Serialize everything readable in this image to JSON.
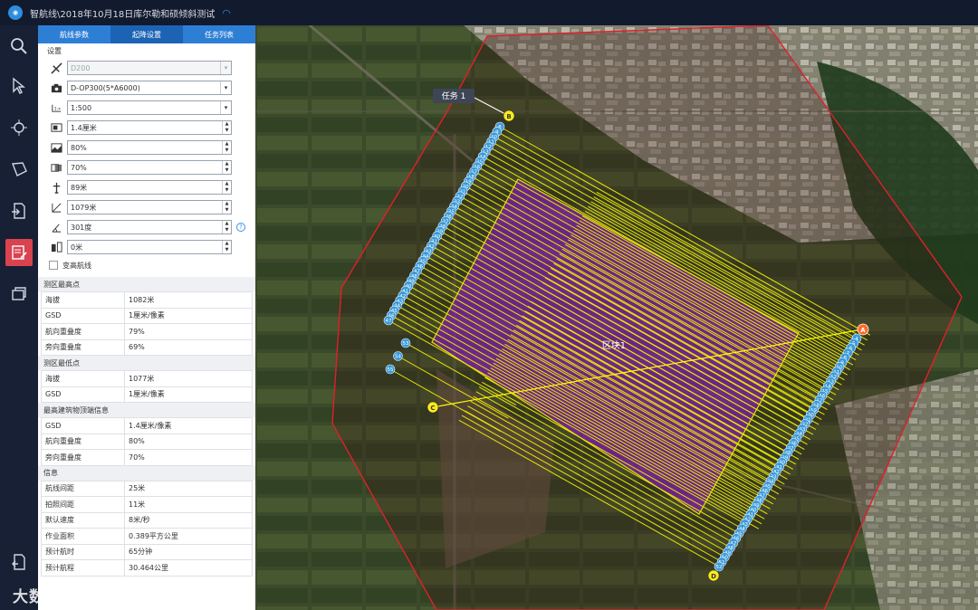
{
  "window": {
    "title": "智航线\\2018年10月18日库尔勒和硕倾斜测试"
  },
  "tabs": [
    {
      "label": "航线参数"
    },
    {
      "label": "起降设置"
    },
    {
      "label": "任务列表"
    }
  ],
  "settings": {
    "heading": "设置",
    "drone": "D200",
    "camera": "D-OP300(5*A6000)",
    "scale": "1:500",
    "gsd": "1.4厘米",
    "forward_overlap": "80%",
    "side_overlap": "70%",
    "altitude": "89米",
    "length": "1079米",
    "heading_angle": "301度",
    "offset": "0米",
    "checkbox_label": "变高航线"
  },
  "highest": {
    "heading": "测区最高点",
    "rows": [
      {
        "k": "海拔",
        "v": "1082米"
      },
      {
        "k": "GSD",
        "v": "1厘米/像素"
      },
      {
        "k": "航向重叠度",
        "v": "79%"
      },
      {
        "k": "旁向重叠度",
        "v": "69%"
      }
    ]
  },
  "lowest": {
    "heading": "测区最低点",
    "rows": [
      {
        "k": "海拔",
        "v": "1077米"
      },
      {
        "k": "GSD",
        "v": "1厘米/像素"
      }
    ]
  },
  "building": {
    "heading": "最高建筑物顶端信息",
    "rows": [
      {
        "k": "GSD",
        "v": "1.4厘米/像素"
      },
      {
        "k": "航向重叠度",
        "v": "80%"
      },
      {
        "k": "旁向重叠度",
        "v": "70%"
      }
    ]
  },
  "info": {
    "heading": "信息",
    "rows": [
      {
        "k": "航线间距",
        "v": "25米"
      },
      {
        "k": "拍照间距",
        "v": "11米"
      },
      {
        "k": "默认速度",
        "v": "8米/秒"
      },
      {
        "k": "作业面积",
        "v": "0.389平方公里"
      },
      {
        "k": "预计航时",
        "v": "65分钟"
      },
      {
        "k": "预计航程",
        "v": "30.464公里"
      }
    ]
  },
  "map": {
    "task_label": "任务 1",
    "area_label": "区块1",
    "point_labels": [
      "A",
      "B",
      "C",
      "D"
    ],
    "line_left_top": [
      "8",
      "9",
      "10",
      "11",
      "12",
      "13",
      "14",
      "15",
      "16",
      "17",
      "18",
      "19",
      "20",
      "21",
      "22",
      "23",
      "24",
      "25",
      "26",
      "27",
      "28",
      "29",
      "30",
      "31",
      "32",
      "33",
      "34",
      "35",
      "36",
      "37",
      "38",
      "39",
      "40",
      "41",
      "42",
      "43",
      "44",
      "45",
      "46",
      "47"
    ],
    "line_left_mid": [
      "53",
      "54",
      "55"
    ],
    "line_right": [
      "4",
      "5",
      "6",
      "7",
      "8",
      "9",
      "10",
      "11",
      "12",
      "13",
      "14",
      "15",
      "16",
      "17",
      "18",
      "19",
      "20",
      "21",
      "22",
      "23",
      "24",
      "25",
      "26",
      "27",
      "28",
      "29",
      "30",
      "31",
      "32",
      "33",
      "34",
      "35",
      "36",
      "37",
      "38",
      "39",
      "40",
      "41",
      "42",
      "43",
      "44",
      "45",
      "46",
      "47",
      "48",
      "49",
      "50",
      "51",
      "52"
    ]
  },
  "watermark": "大数跨境",
  "colors": {
    "accent": "#2d7fd6",
    "active_tool": "#d9434f",
    "route": "#ffff00",
    "area": "#7a1fa2",
    "boundary": "#e0202a",
    "waypoint": "#3b9ad9"
  }
}
